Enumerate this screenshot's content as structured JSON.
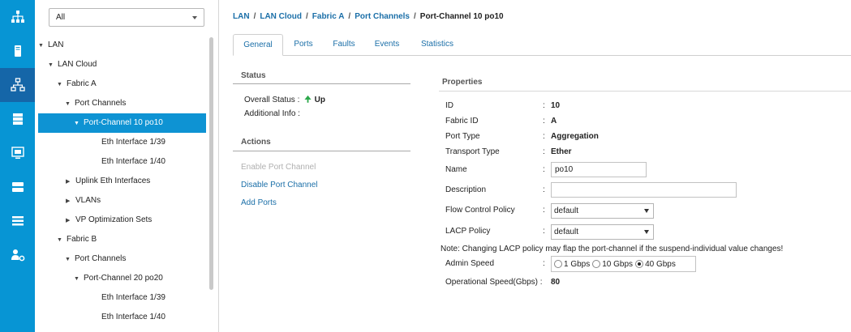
{
  "nav_rail": {
    "items": [
      {
        "icon": "network-icon",
        "active": false
      },
      {
        "icon": "server-icon",
        "active": false
      },
      {
        "icon": "lan-icon",
        "active": true
      },
      {
        "icon": "san-icon",
        "active": false
      },
      {
        "icon": "vm-icon",
        "active": false
      },
      {
        "icon": "storage-icon",
        "active": false
      },
      {
        "icon": "list-icon",
        "active": false
      },
      {
        "icon": "admin-icon",
        "active": false
      }
    ]
  },
  "filter": {
    "value": "All"
  },
  "tree": {
    "items": [
      {
        "label": "LAN",
        "arrow": "▼",
        "selected": false
      },
      {
        "label": "LAN Cloud",
        "arrow": "▼",
        "selected": false
      },
      {
        "label": "Fabric A",
        "arrow": "▼",
        "selected": false
      },
      {
        "label": "Port Channels",
        "arrow": "▼",
        "selected": false
      },
      {
        "label": "Port-Channel 10 po10",
        "arrow": "▼",
        "selected": true
      },
      {
        "label": "Eth Interface 1/39",
        "arrow": "",
        "selected": false
      },
      {
        "label": "Eth Interface 1/40",
        "arrow": "",
        "selected": false
      },
      {
        "label": "Uplink Eth Interfaces",
        "arrow": "▶",
        "selected": false
      },
      {
        "label": "VLANs",
        "arrow": "▶",
        "selected": false
      },
      {
        "label": "VP Optimization Sets",
        "arrow": "▶",
        "selected": false
      },
      {
        "label": "Fabric B",
        "arrow": "▼",
        "selected": false
      },
      {
        "label": "Port Channels",
        "arrow": "▼",
        "selected": false
      },
      {
        "label": "Port-Channel 20 po20",
        "arrow": "▼",
        "selected": false
      },
      {
        "label": "Eth Interface 1/39",
        "arrow": "",
        "selected": false
      },
      {
        "label": "Eth Interface 1/40",
        "arrow": "",
        "selected": false
      }
    ]
  },
  "breadcrumb": {
    "items": [
      "LAN",
      "LAN Cloud",
      "Fabric A",
      "Port Channels",
      "Port-Channel 10 po10"
    ],
    "separator": "/"
  },
  "tabs": {
    "items": [
      "General",
      "Ports",
      "Faults",
      "Events",
      "Statistics"
    ],
    "active": "General"
  },
  "status": {
    "title": "Status",
    "overall_label": "Overall Status :",
    "overall_value": "Up",
    "additional_label": "Additional Info :"
  },
  "actions": {
    "title": "Actions",
    "items": [
      {
        "label": "Enable Port Channel",
        "enabled": false
      },
      {
        "label": "Disable Port Channel",
        "enabled": true
      },
      {
        "label": "Add Ports",
        "enabled": true
      }
    ]
  },
  "properties": {
    "title": "Properties",
    "id_label": "ID",
    "id_value": "10",
    "fabric_label": "Fabric ID",
    "fabric_value": "A",
    "port_type_label": "Port Type",
    "port_type_value": "Aggregation",
    "transport_label": "Transport Type",
    "transport_value": "Ether",
    "name_label": "Name",
    "name_value": "po10",
    "description_label": "Description",
    "description_value": "",
    "flow_control_label": "Flow Control Policy",
    "flow_control_value": "default",
    "lacp_label": "LACP Policy",
    "lacp_value": "default",
    "note": "Note: Changing LACP policy may flap the port-channel if the suspend-individual value changes!",
    "admin_speed_label": "Admin Speed",
    "admin_speed_options": [
      "1 Gbps",
      "10 Gbps",
      "40 Gbps"
    ],
    "admin_speed_selected": "40 Gbps",
    "oper_speed_label": "Operational Speed(Gbps) :",
    "oper_speed_value": "80",
    "colon": ":"
  },
  "colors": {
    "rail": "#0795d4",
    "rail_active": "#1566a8",
    "selection": "#0e93d3",
    "link": "#1b6fa8",
    "status_up": "#2ba84a"
  }
}
